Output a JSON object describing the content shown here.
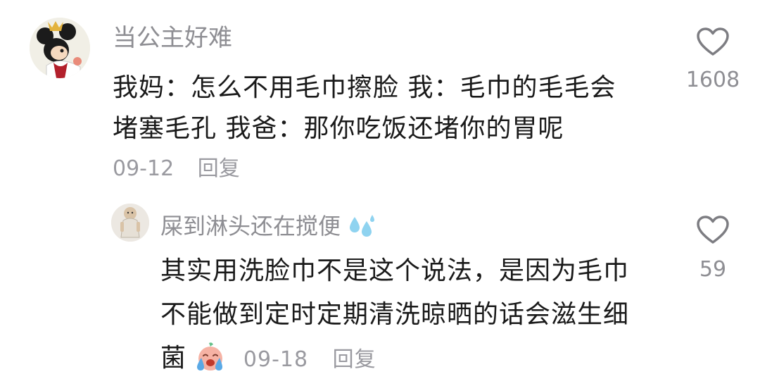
{
  "comments": [
    {
      "username": "当公主好难",
      "avatar_icon": "mickey-princess-avatar",
      "lines": [
        "我妈：怎么不用毛巾擦脸   我：毛巾的毛毛会",
        "堵塞毛孔  我爸：那你吃饭还堵你的胃呢"
      ],
      "date": "09-12",
      "reply_label": "回复",
      "likes": "1608",
      "heart_icon": "heart-outline-icon"
    },
    {
      "username": "屎到淋头还在搅便",
      "username_emoji": "sweat-droplets-icon",
      "avatar_icon": "doll-avatar",
      "lines": [
        "其实用洗脸巾不是这个说法，是因为毛巾",
        "不能做到定时定期清洗晾晒的话会滋生细",
        "菌"
      ],
      "trailing_emoji": "crying-face-icon",
      "date": "09-18",
      "reply_label": "回复",
      "likes": "59",
      "heart_icon": "heart-outline-icon"
    }
  ],
  "colors": {
    "username": "#8e8e93",
    "content": "#1a1a1a",
    "meta": "#9a9aa0",
    "heart_stroke": "#7d7d82",
    "droplet": "#8fd3f0",
    "crying_face": "#f6b2a4"
  }
}
